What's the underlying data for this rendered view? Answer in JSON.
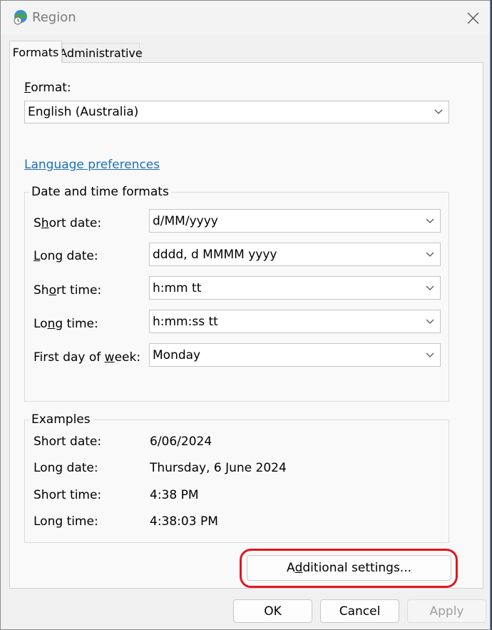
{
  "window": {
    "title": "Region"
  },
  "tabs": [
    {
      "label": "Formats",
      "selected": true
    },
    {
      "label": "Administrative",
      "selected": false
    }
  ],
  "format": {
    "label_mnemonic": "F",
    "label_rest": "ormat:",
    "value": "English (Australia)"
  },
  "language_link": "Language preferences",
  "date_time_formats": {
    "title": "Date and time formats",
    "rows": [
      {
        "pre": "S",
        "mn": "h",
        "post": "ort date:",
        "value": "d/MM/yyyy"
      },
      {
        "pre": "",
        "mn": "L",
        "post": "ong date:",
        "value": "dddd, d MMMM yyyy"
      },
      {
        "pre": "Sh",
        "mn": "o",
        "post": "rt time:",
        "value": "h:mm tt"
      },
      {
        "pre": "Lo",
        "mn": "n",
        "post": "g time:",
        "value": "h:mm:ss tt"
      },
      {
        "pre": "First day of ",
        "mn": "w",
        "post": "eek:",
        "value": "Monday"
      }
    ]
  },
  "examples": {
    "title": "Examples",
    "rows": [
      {
        "label": "Short date:",
        "value": "6/06/2024"
      },
      {
        "label": "Long date:",
        "value": "Thursday, 6 June 2024"
      },
      {
        "label": "Short time:",
        "value": "4:38 PM"
      },
      {
        "label": "Long time:",
        "value": "4:38:03 PM"
      }
    ]
  },
  "buttons": {
    "additional_pre": "A",
    "additional_mn": "d",
    "additional_post": "ditional settings...",
    "ok": "OK",
    "cancel": "Cancel",
    "apply": "Apply"
  },
  "colors": {
    "link": "#1f6fb8",
    "highlight": "#e2171e"
  },
  "icons": {
    "title": "globe-clock-icon",
    "close": "close-icon",
    "dropdown": "chevron-down-icon"
  }
}
